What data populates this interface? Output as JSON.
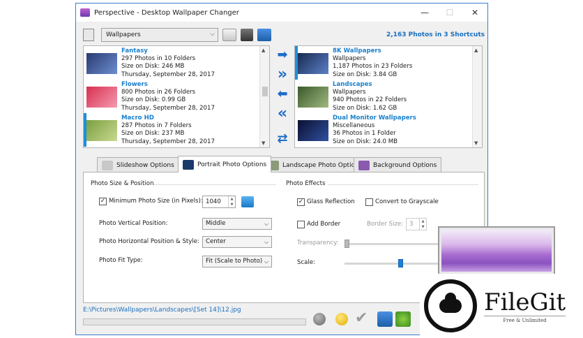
{
  "window": {
    "title": "Perspective - Desktop Wallpaper Changer",
    "minimize": "—",
    "maximize": "☐",
    "close": "✕"
  },
  "toolbar": {
    "library_selected": "Wallpapers",
    "shortcut_count": "2,163 Photos in 3 Shortcuts"
  },
  "left_list": [
    {
      "name": "Fantasy",
      "photos": "297 Photos in 10 Folders",
      "size": "Size on Disk: 246 MB",
      "date": "Thursday, September 28, 2017",
      "thumb_colors": [
        "#2a3a70",
        "#6b8fd0"
      ]
    },
    {
      "name": "Flowers",
      "photos": "800 Photos in 26 Folders",
      "size": "Size on Disk: 0.99 GB",
      "date": "Thursday, September 28, 2017",
      "thumb_colors": [
        "#d83050",
        "#f49ab0"
      ]
    },
    {
      "name": "Macro HD",
      "photos": "287 Photos in 7 Folders",
      "size": "Size on Disk: 237 MB",
      "date": "Thursday, September 28, 2017",
      "thumb_colors": [
        "#7aa040",
        "#c8d890"
      ]
    }
  ],
  "right_list": [
    {
      "name": "8K Wallpapers",
      "category": "Wallpapers",
      "photos": "1,187 Photos in 23 Folders",
      "size": "Size on Disk: 3.84 GB",
      "thumb_colors": [
        "#1a2a50",
        "#5a80c8"
      ]
    },
    {
      "name": "Landscapes",
      "category": "Wallpapers",
      "photos": "940 Photos in 22 Folders",
      "size": "Size on Disk: 1.62 GB",
      "thumb_colors": [
        "#3a5a2a",
        "#a0b880"
      ]
    },
    {
      "name": "Dual Monitor Wallpapers",
      "category": "Miscellaneous",
      "photos": "36 Photos in 1 Folder",
      "size": "Size on Disk: 24.0 MB",
      "thumb_colors": [
        "#0a1030",
        "#3050a0"
      ]
    }
  ],
  "movers": [
    "➡",
    "»",
    "⬅",
    "«",
    "⇄"
  ],
  "tabs": [
    {
      "label": "Slideshow Options",
      "color": "#c8c8c8"
    },
    {
      "label": "Portrait Photo Options",
      "color": "#1a3a6a"
    },
    {
      "label": "Landscape Photo Options",
      "color": "#8a9a7a"
    },
    {
      "label": "Background Options",
      "color": "#8a5ab0"
    }
  ],
  "portrait": {
    "size_section": "Photo Size & Position",
    "min_size_label": "Minimum Photo Size (in Pixels):",
    "min_size_checked": "✓",
    "min_size_value": "1040",
    "vertical_label": "Photo Vertical Position:",
    "vertical_value": "Middle",
    "horizontal_label": "Photo Horizontal Position & Style:",
    "horizontal_value": "Center",
    "fit_label": "Photo Fit Type:",
    "fit_value": "Fit (Scale to Photo)",
    "effects_section": "Photo Effects",
    "glass_label": "Glass Reflection",
    "glass_checked": "✓",
    "gray_label": "Convert to Grayscale",
    "border_label": "Add Border",
    "border_size_label": "Border Size:",
    "border_size_value": "3",
    "transparency_label": "Transparency:",
    "scale_label": "Scale:",
    "transparency_level": 0.0,
    "scale_level": 0.55
  },
  "status": {
    "path": "E:\\Pictures\\Wallpapers\\Landscapes\\[Set 14]\\12.jpg",
    "progress": 0.0
  },
  "watermark": {
    "name": "FileGit",
    "tagline": "Free & Unlimited"
  }
}
